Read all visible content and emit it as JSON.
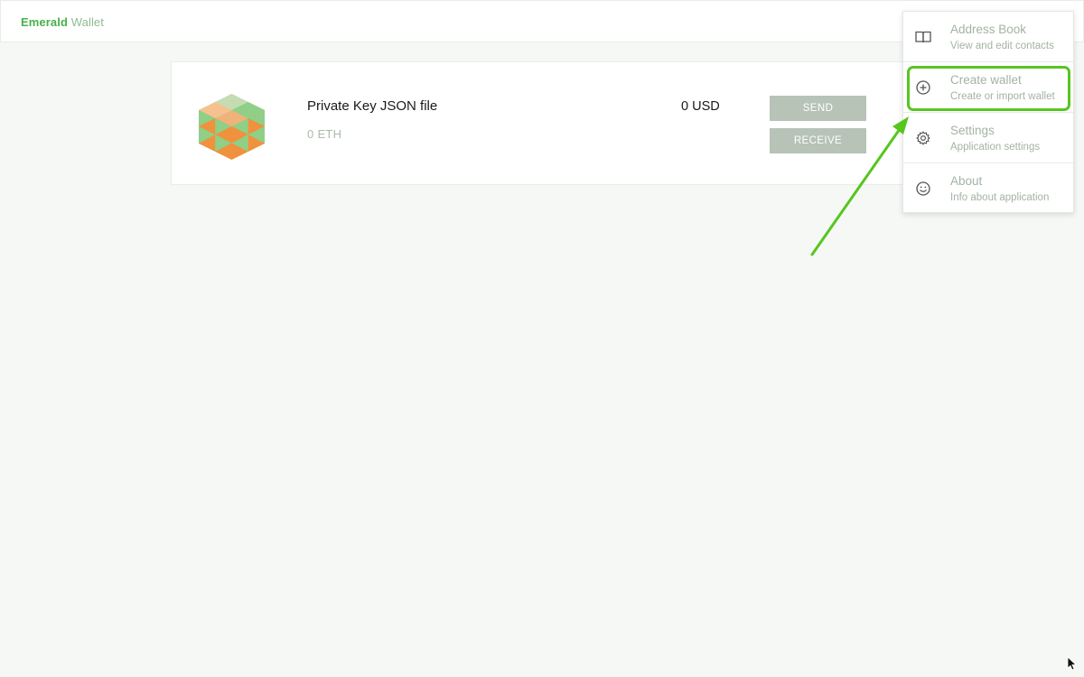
{
  "header": {
    "brand_primary": "Emerald",
    "brand_secondary": "Wallet"
  },
  "wallet": {
    "name": "Private Key JSON file",
    "balance": "0 ETH",
    "fiat": "0 USD",
    "send_label": "SEND",
    "receive_label": "RECEIVE"
  },
  "menu": {
    "items": [
      {
        "title": "Address Book",
        "subtitle": "View and edit contacts",
        "icon": "book-icon"
      },
      {
        "title": "Create wallet",
        "subtitle": "Create or import wallet",
        "icon": "plus-circle-icon"
      },
      {
        "title": "Settings",
        "subtitle": "Application settings",
        "icon": "gear-icon"
      },
      {
        "title": "About",
        "subtitle": "Info about application",
        "icon": "smiley-icon"
      }
    ]
  },
  "colors": {
    "brand_green": "#47b04b",
    "button_bg": "#b6c3b6",
    "highlight": "#56c61f",
    "background": "#f6f8f6"
  }
}
